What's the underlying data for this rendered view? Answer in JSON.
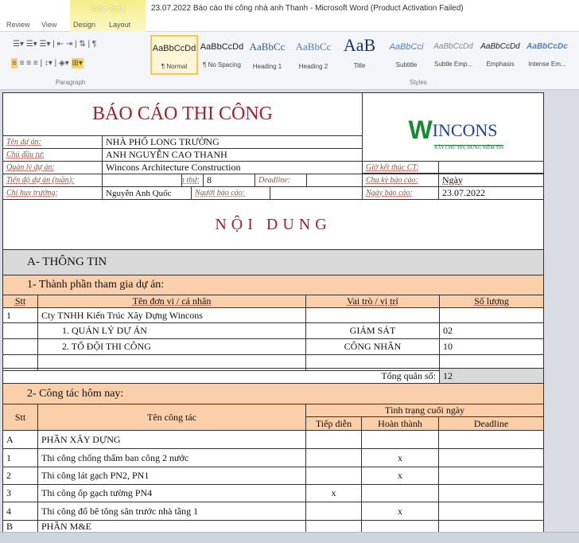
{
  "window": {
    "title": "23.07.2022 Báo cáo thi công nhà anh Thanh  -  Microsoft Word (Product Activation Failed)",
    "context_tab": "Table Tools"
  },
  "tabs": [
    "Review",
    "View",
    "Design",
    "Layout"
  ],
  "styles": [
    {
      "preview": "AaBbCcDd",
      "label": "¶ Normal"
    },
    {
      "preview": "AaBbCcDd",
      "label": "¶ No Spacing"
    },
    {
      "preview": "AaBbCc",
      "label": "Heading 1"
    },
    {
      "preview": "AaBbCc",
      "label": "Heading 2"
    },
    {
      "preview": "AaB",
      "label": "Title"
    },
    {
      "preview": "AaBbCci",
      "label": "Subtitle"
    },
    {
      "preview": "AaBbCcDd",
      "label": "Subtle Emp..."
    },
    {
      "preview": "AaBbCcDd",
      "label": "Emphasis"
    },
    {
      "preview": "AaBbCcDc",
      "label": "Intense Em..."
    }
  ],
  "groups": {
    "paragraph": "Paragraph",
    "styles": "Styles"
  },
  "report": {
    "title": "BÁO CÁO THI CÔNG",
    "logo": {
      "name": "WINCONS",
      "slogan": "XÂY CHỮ TÍN, DỰNG NIỀM TIN",
      "color": "#1a8a2e"
    },
    "labels": {
      "project": "Tên dự án:",
      "owner": "Chủ đầu tư:",
      "manager": "Quản lý dự án:",
      "progress": "Tiến độ dự án (tuần):",
      "week": "Tuần thứ:",
      "deadline": "Deadline:",
      "end_time": "Giờ kết thúc CT:",
      "cycle": "Chu kỳ báo cáo:",
      "chief": "Chỉ huy trưởng:",
      "reporter": "Người báo cáo:",
      "date": "Ngày báo cáo:"
    },
    "values": {
      "project": "NHÀ PHỐ LONG TRƯỜNG",
      "owner": "ANH NGUYỄN CAO THANH",
      "manager": "Wincons Architecture Construction",
      "week": "8",
      "cycle": "Ngày",
      "chief": "Nguyễn Anh Quốc",
      "date": "23.07.2022"
    },
    "content_title": "NỘI DUNG",
    "section_a": "A-  THÔNG TIN",
    "section_1": "1-   Thành phần tham gia dự án:",
    "t1_headers": [
      "Stt",
      "Tên đơn vị / cá nhân",
      "Vai trò / vị trí",
      "Số lượng"
    ],
    "t1_rows": [
      [
        "1",
        "Cty TNHH Kiến Trúc Xây Dựng Wincons",
        "",
        ""
      ],
      [
        "",
        "1.   QUẢN LÝ DỰ ÁN",
        "GIÁM SÁT",
        "02"
      ],
      [
        "",
        "2.   TỔ ĐỘI THI CÔNG",
        "CÔNG NHÂN",
        "10"
      ],
      [
        "",
        "",
        "",
        ""
      ]
    ],
    "total_label": "Tổng quân số:",
    "total_value": "12",
    "section_2": "2-   Công tác hôm nay:",
    "t2_headers": {
      "stt": "Stt",
      "name": "Tên công tác",
      "status": "Tình trạng cuối ngày",
      "ongoing": "Tiếp diễn",
      "done": "Hoàn thành",
      "deadline": "Deadline"
    },
    "t2_rows": [
      [
        "A",
        "PHẦN XÂY DỰNG",
        "",
        "",
        ""
      ],
      [
        "1",
        "Thi công chống thấm ban công 2 nước",
        "",
        "x",
        ""
      ],
      [
        "2",
        "Thi công lát gạch PN2, PN1",
        "",
        "x",
        ""
      ],
      [
        "3",
        "Thi công ốp gạch tường PN4",
        "x",
        "",
        ""
      ],
      [
        "4",
        "Thi công đổ bê tông sân trước nhà tầng 1",
        "",
        "x",
        ""
      ],
      [
        "B",
        "PHẦN M&E",
        "",
        "",
        ""
      ]
    ]
  },
  "colors": {
    "title_red": "#a3232a",
    "orange": "#fbcfa9",
    "gray": "#d9d9d9"
  }
}
